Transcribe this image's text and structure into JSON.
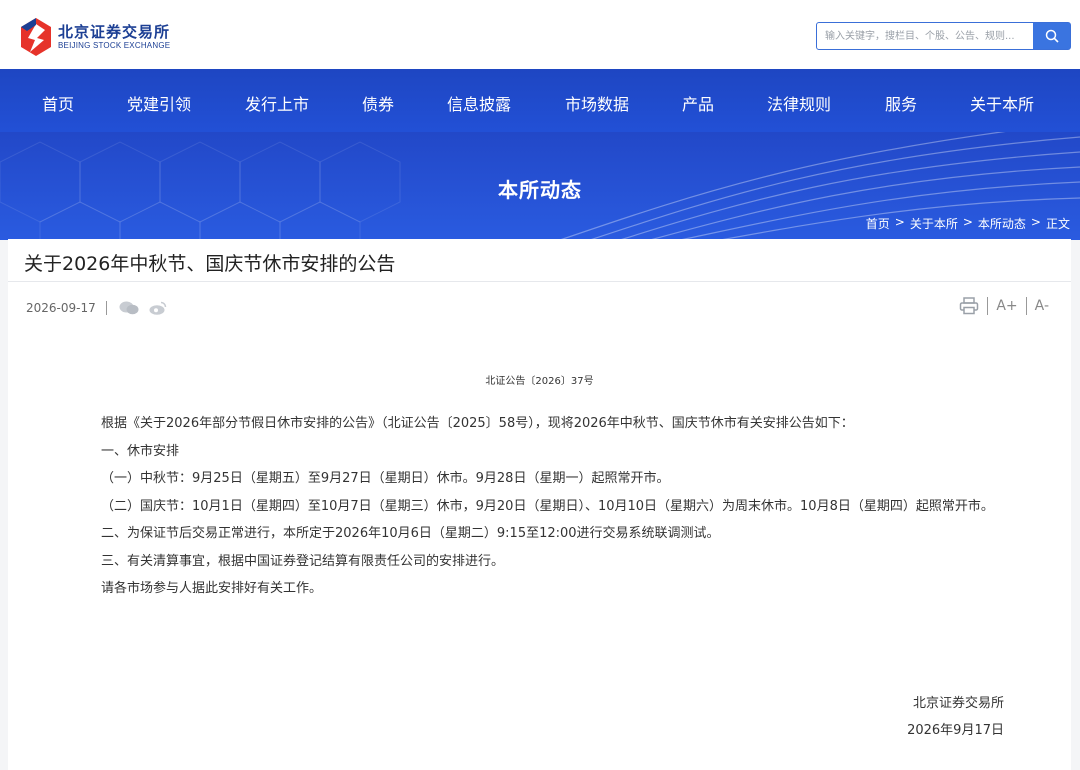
{
  "header": {
    "logo_cn": "北京证券交易所",
    "logo_en": "BEIJING STOCK EXCHANGE",
    "search_placeholder": "输入关键字，搜栏目、个股、公告、规则...",
    "brand_red": "#e6332a",
    "brand_blue": "#1c3f94"
  },
  "nav": {
    "items": [
      "首页",
      "党建引领",
      "发行上市",
      "债券",
      "信息披露",
      "市场数据",
      "产品",
      "法律规则",
      "服务",
      "关于本所"
    ],
    "color": "#2250d6"
  },
  "banner": {
    "title": "本所动态",
    "breadcrumb": [
      "首页",
      ">",
      "关于本所",
      ">",
      "本所动态",
      ">",
      "正文"
    ]
  },
  "article": {
    "title": "关于2026年中秋节、国庆节休市安排的公告",
    "date": "2026-09-17",
    "share_icons": [
      "wechat-icon",
      "weibo-icon"
    ],
    "tools": [
      "print-icon",
      "A+",
      "A-"
    ],
    "doc_no": "北证公告〔2026〕37号",
    "paragraphs": [
      "根据《关于2026年部分节假日休市安排的公告》（北证公告〔2025〕58号），现将2026年中秋节、国庆节休市有关安排公告如下：",
      "一、休市安排",
      "（一）中秋节：9月25日（星期五）至9月27日（星期日）休市。9月28日（星期一）起照常开市。",
      "（二）国庆节：10月1日（星期四）至10月7日（星期三）休市，9月20日（星期日）、10月10日（星期六）为周末休市。10月8日（星期四）起照常开市。",
      "二、为保证节后交易正常进行，本所定于2026年10月6日（星期二）9:15至12:00进行交易系统联调测试。",
      "三、有关清算事宜，根据中国证券登记结算有限责任公司的安排进行。",
      "请各市场参与人据此安排好有关工作。"
    ],
    "signature_org": "北京证券交易所",
    "signature_date": "2026年9月17日"
  }
}
